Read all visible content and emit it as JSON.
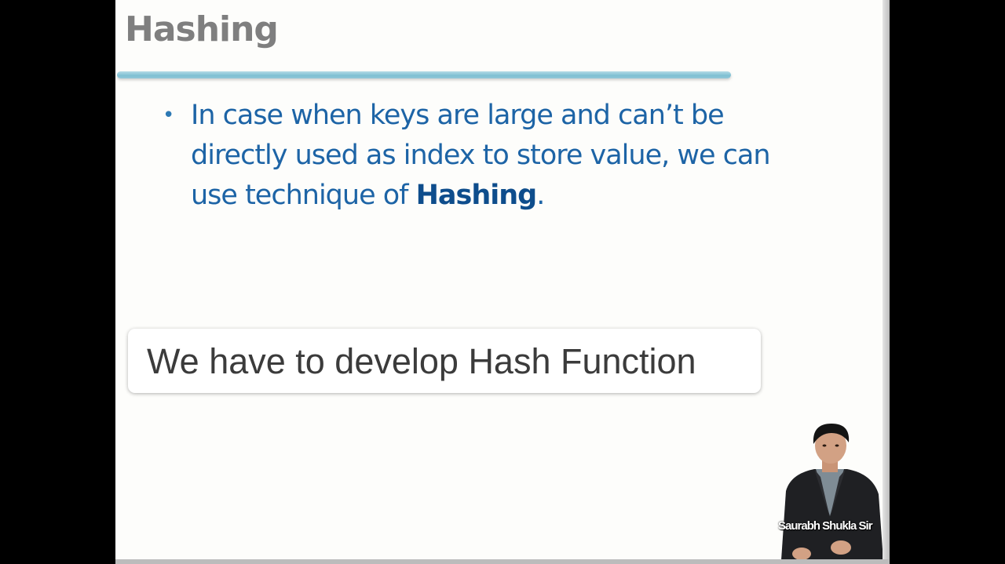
{
  "slide": {
    "title": "Hashing",
    "bullet_marker": "•",
    "bullet_text_prefix": "In case when keys are large and can’t be directly used as index to store value, we can use technique of ",
    "bullet_text_emphasis": "Hashing",
    "bullet_text_suffix": "."
  },
  "caption": {
    "text": "We have to develop Hash Function"
  },
  "presenter": {
    "name": "Saurabh Shukla Sir"
  },
  "colors": {
    "title": "#7f7f7f",
    "rule": "#7fbfd2",
    "body_text": "#1d64a6",
    "background": "#000000",
    "slide_background": "#fdfdfb"
  }
}
